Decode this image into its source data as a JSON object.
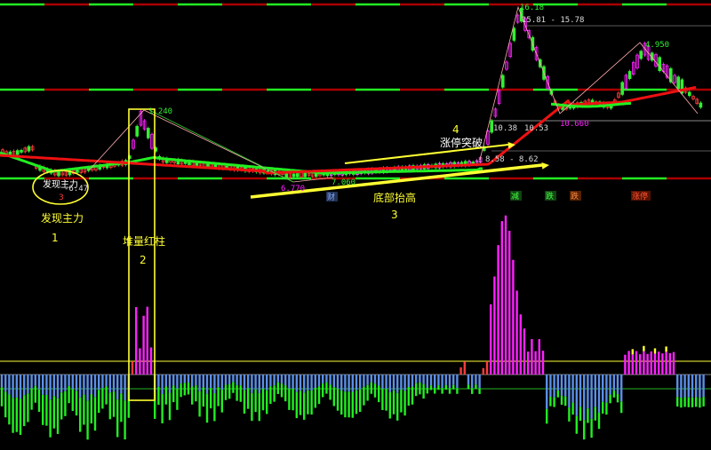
{
  "chart_data": {
    "type": "candlestick",
    "price_labels": {
      "p_6_47": "-6.47",
      "p_1_240": "1.240",
      "p_6_770": "6.770",
      "p_7_060": "7.060",
      "p_8_48_8_62": "8.58 - 8.62",
      "p_10_38": "10.38",
      "p_10_53": "10.53",
      "p_10_660": "10.660",
      "p_15_81_15_78": "15.81 - 15.78",
      "p_16_18": "16.18",
      "p_4_950": "4.950"
    },
    "tags": [
      "财",
      "减",
      "跌",
      "跌",
      "涨停"
    ],
    "annotations": [
      {
        "num": "1",
        "text": "发现主力"
      },
      {
        "num": "2",
        "text": "堆量红柱"
      },
      {
        "num": "3",
        "text": "底部抬高"
      },
      {
        "num": "4",
        "text": "涨停突破"
      }
    ],
    "inline_label": "发现主力",
    "inline_sub": "3",
    "colors": {
      "up": "#ff3b3b",
      "down": "#33ee33",
      "magenta": "#ff22ff",
      "yellow": "#ffff33",
      "blue": "#5b8fe6",
      "green_line": "#22ee22",
      "red_line": "#ee1111"
    }
  }
}
